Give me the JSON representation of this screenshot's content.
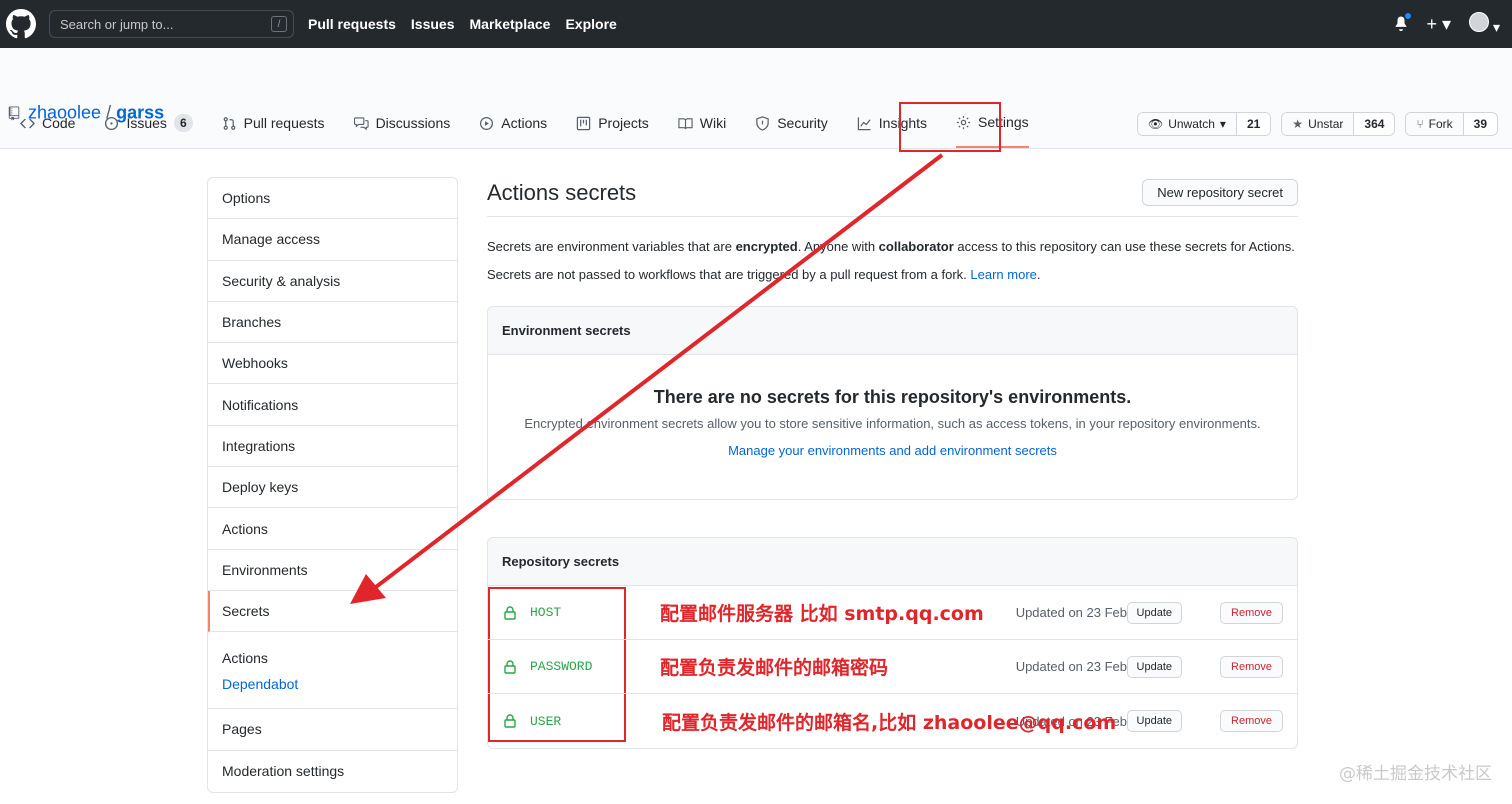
{
  "header": {
    "search_placeholder": "Search or jump to...",
    "search_shortcut": "/",
    "nav": [
      "Pull requests",
      "Issues",
      "Marketplace",
      "Explore"
    ]
  },
  "repo": {
    "owner": "zhaoolee",
    "separator": "/",
    "name": "garss",
    "watch_label": "Unwatch",
    "watch_count": "21",
    "star_label": "Unstar",
    "star_count": "364",
    "fork_label": "Fork",
    "fork_count": "39"
  },
  "tabs": [
    {
      "label": "Code"
    },
    {
      "label": "Issues",
      "count": "6"
    },
    {
      "label": "Pull requests"
    },
    {
      "label": "Discussions"
    },
    {
      "label": "Actions"
    },
    {
      "label": "Projects"
    },
    {
      "label": "Wiki"
    },
    {
      "label": "Security"
    },
    {
      "label": "Insights"
    },
    {
      "label": "Settings"
    }
  ],
  "sidebar": {
    "items": [
      "Options",
      "Manage access",
      "Security & analysis",
      "Branches",
      "Webhooks",
      "Notifications",
      "Integrations",
      "Deploy keys",
      "Actions",
      "Environments",
      "Secrets"
    ],
    "group_heading": "Actions",
    "group_link": "Dependabot",
    "bottom_items": [
      "Pages",
      "Moderation settings"
    ]
  },
  "main": {
    "title": "Actions secrets",
    "new_button": "New repository secret",
    "desc1_a": "Secrets are environment variables that are ",
    "desc1_b": "encrypted",
    "desc1_c": ". Anyone with ",
    "desc1_d": "collaborator",
    "desc1_e": " access to this repository can use these secrets for Actions.",
    "desc2_a": "Secrets are not passed to workflows that are triggered by a pull request from a fork. ",
    "desc2_link": "Learn more",
    "desc2_end": ".",
    "env_heading": "Environment secrets",
    "env_blank_title": "There are no secrets for this repository's environments.",
    "env_blank_desc": "Encrypted environment secrets allow you to store sensitive information, such as access tokens, in your repository environments.",
    "env_blank_link": "Manage your environments and add environment secrets",
    "repo_heading": "Repository secrets",
    "secrets": [
      {
        "name": "HOST",
        "note": "配置邮件服务器 比如 smtp.qq.com",
        "updated": "Updated on 23 Feb"
      },
      {
        "name": "PASSWORD",
        "note": "配置负责发邮件的邮箱密码",
        "updated": "Updated on 23 Feb"
      },
      {
        "name": "USER",
        "note": "配置负责发邮件的邮箱名,比如  zhaoolee@qq.com",
        "updated": "Updated on 23 Feb"
      }
    ],
    "update_label": "Update",
    "remove_label": "Remove"
  },
  "watermark": "@稀土掘金技术社区",
  "colors": {
    "annotation": "#e0262b",
    "link": "#0366d6",
    "secret_name": "#28a745",
    "header_bg": "#24292e"
  }
}
